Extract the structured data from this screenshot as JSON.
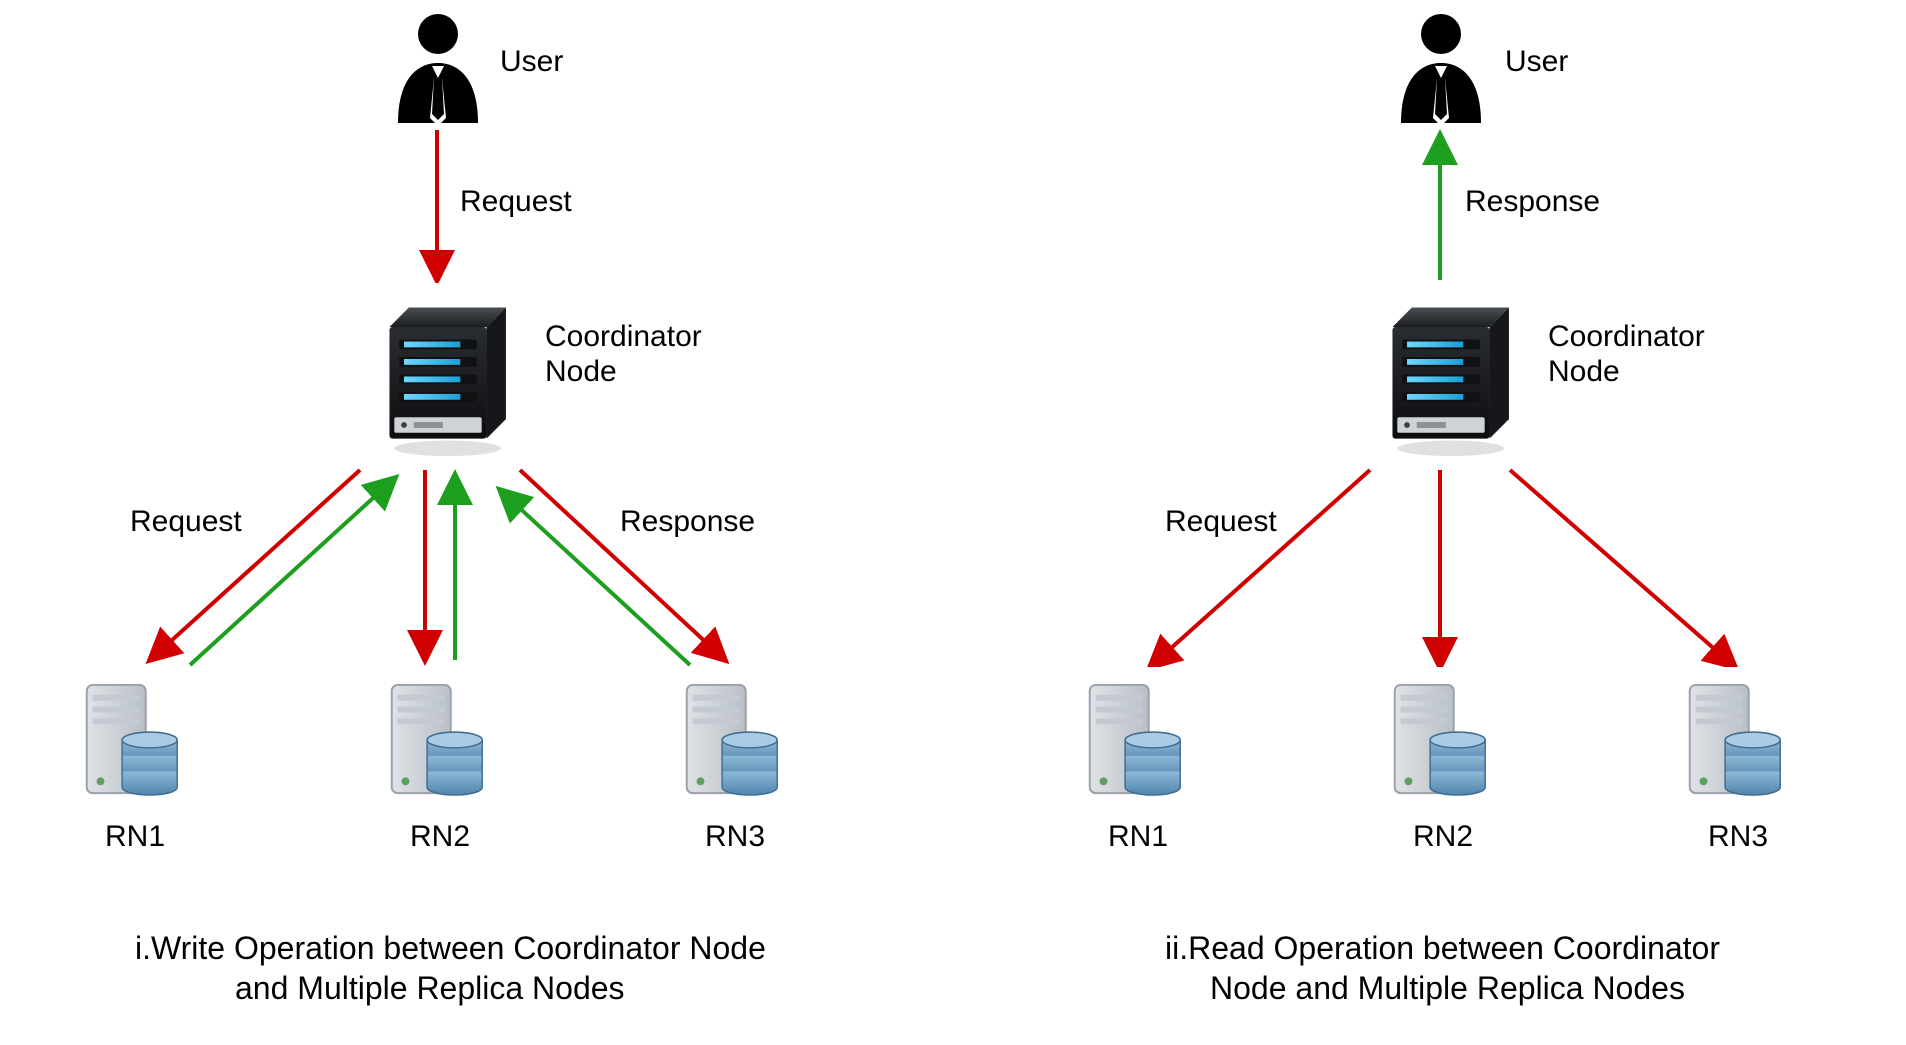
{
  "colors": {
    "request": "#d10000",
    "response": "#1e9e1e",
    "text": "#000000"
  },
  "left": {
    "user_label": "User",
    "request_label": "Request",
    "coordinator_label": "Coordinator\nNode",
    "request2_label": "Request",
    "response_label": "Response",
    "caption_top": "i.Write Operation between Coordinator Node",
    "caption_bottom": "and Multiple Replica Nodes"
  },
  "right": {
    "user_label": "User",
    "response_label": "Response",
    "coordinator_label": "Coordinator\nNode",
    "request_label": "Request",
    "caption_top": "ii.Read Operation between Coordinator",
    "caption_bottom": "Node and Multiple Replica Nodes"
  },
  "db_labels": {
    "left": [
      "RN1",
      "RN2",
      "RN3"
    ],
    "right": [
      "RN1",
      "RN2",
      "RN3"
    ]
  }
}
